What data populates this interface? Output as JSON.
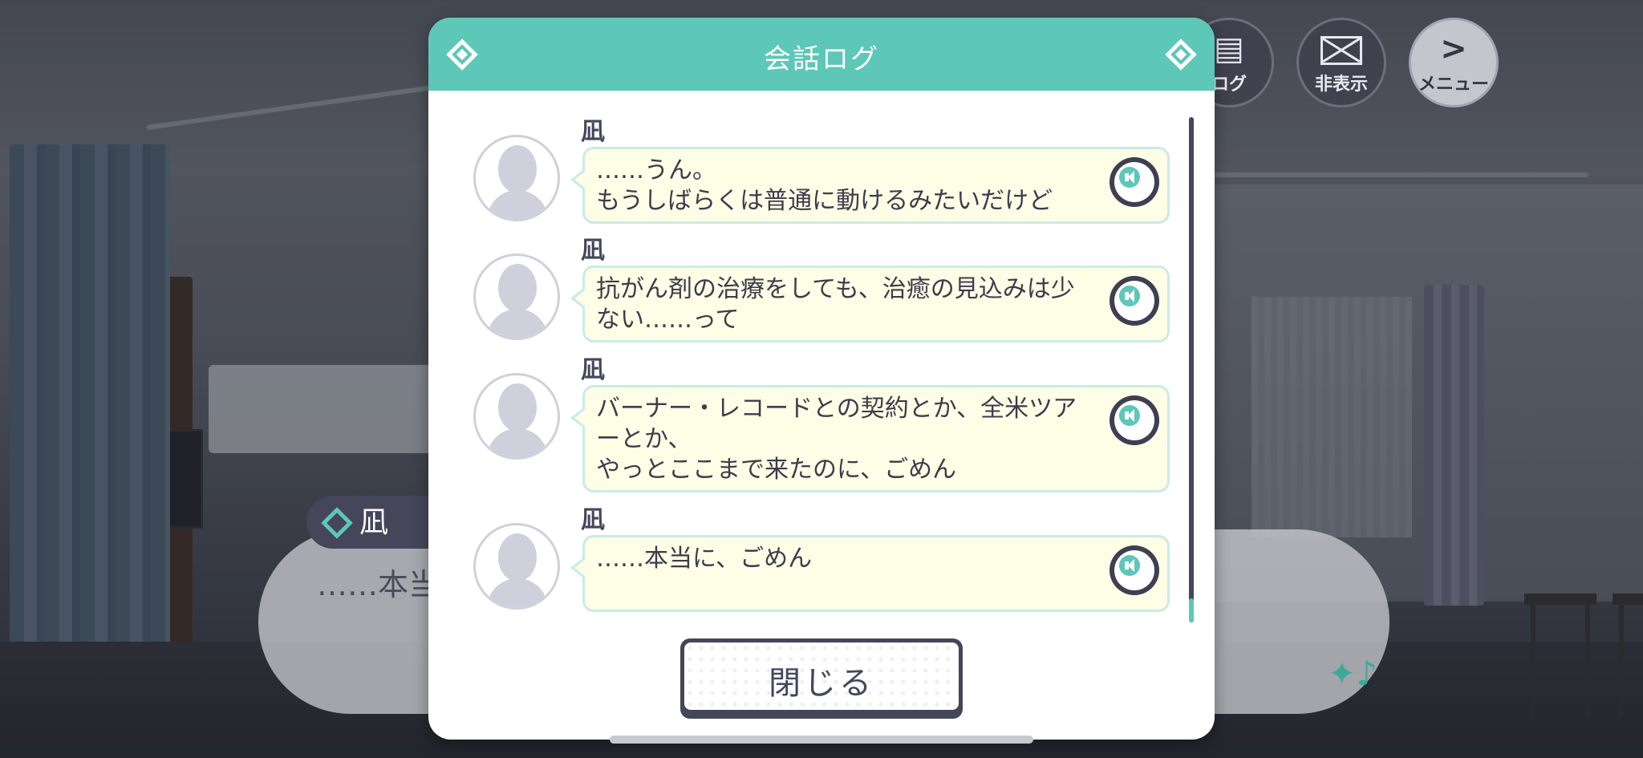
{
  "top_buttons": {
    "log_label": "ログ",
    "hide_label": "非表示",
    "menu_label": "メニュー"
  },
  "dialogue": {
    "speaker": "凪",
    "text": "……本当"
  },
  "modal": {
    "title": "会話ログ",
    "entries": [
      {
        "speaker": "凪",
        "text": "……うん。\nもうしばらくは普通に動けるみたいだけど"
      },
      {
        "speaker": "凪",
        "text": "抗がん剤の治療をしても、治癒の見込みは少\nない……って"
      },
      {
        "speaker": "凪",
        "text": "バーナー・レコードとの契約とか、全米ツア\nーとか、\nやっとここまで来たのに、ごめん"
      },
      {
        "speaker": "凪",
        "text": "……本当に、ごめん"
      }
    ],
    "close_label": "閉じる"
  },
  "colors": {
    "accent": "#5dc7b8",
    "dark": "#45465a",
    "bubble_bg": "#fefde6",
    "bubble_border": "#c8ece6"
  }
}
